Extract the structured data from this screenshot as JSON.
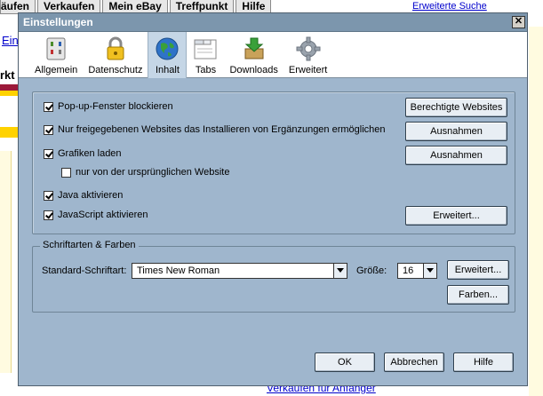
{
  "background": {
    "nav_tabs": [
      "äufen",
      "Verkaufen",
      "Mein eBay",
      "Treffpunkt",
      "Hilfe"
    ],
    "top_right_link": "Erweiterte Suche",
    "left_fragment_1": "Ein",
    "left_fragment_2": "rkt",
    "bottom_link": "Verkaufen für Anfänger"
  },
  "dialog": {
    "title": "Einstellungen",
    "close_label": "✕"
  },
  "toolbar": {
    "items": [
      {
        "label": "Allgemein",
        "icon": "settings-panel-icon"
      },
      {
        "label": "Datenschutz",
        "icon": "padlock-icon"
      },
      {
        "label": "Inhalt",
        "icon": "globe-icon"
      },
      {
        "label": "Tabs",
        "icon": "tabs-window-icon"
      },
      {
        "label": "Downloads",
        "icon": "download-box-icon"
      },
      {
        "label": "Erweitert",
        "icon": "gear-icon"
      }
    ],
    "active": "Inhalt"
  },
  "content": {
    "popup_block": {
      "label": "Pop-up-Fenster blockieren",
      "checked": true
    },
    "addons_only_allowed": {
      "label": "Nur freigegebenen Websites das Installieren von Ergänzungen ermöglichen",
      "checked": true
    },
    "load_images": {
      "label": "Grafiken laden",
      "checked": true
    },
    "images_origin_only": {
      "label": "nur von der ursprünglichen Website",
      "checked": false
    },
    "java_enable": {
      "label": "Java aktivieren",
      "checked": true
    },
    "javascript_enable": {
      "label": "JavaScript aktivieren",
      "checked": true
    },
    "buttons": {
      "allowed_sites": "Berechtigte Websites",
      "exceptions_addons": "Ausnahmen",
      "exceptions_images": "Ausnahmen",
      "js_advanced": "Erweitert..."
    }
  },
  "fonts": {
    "legend": "Schriftarten & Farben",
    "default_font_label": "Standard-Schriftart:",
    "default_font_value": "Times New Roman",
    "size_label": "Größe:",
    "size_value": "16",
    "advanced_button": "Erweitert...",
    "colors_button": "Farben..."
  },
  "footer": {
    "ok": "OK",
    "cancel": "Abbrechen",
    "help": "Hilfe"
  },
  "colors": {
    "dialog_bg": "#9fb6cd",
    "titlebar": "#7c96ad",
    "active_tab": "#c5d6e6"
  }
}
